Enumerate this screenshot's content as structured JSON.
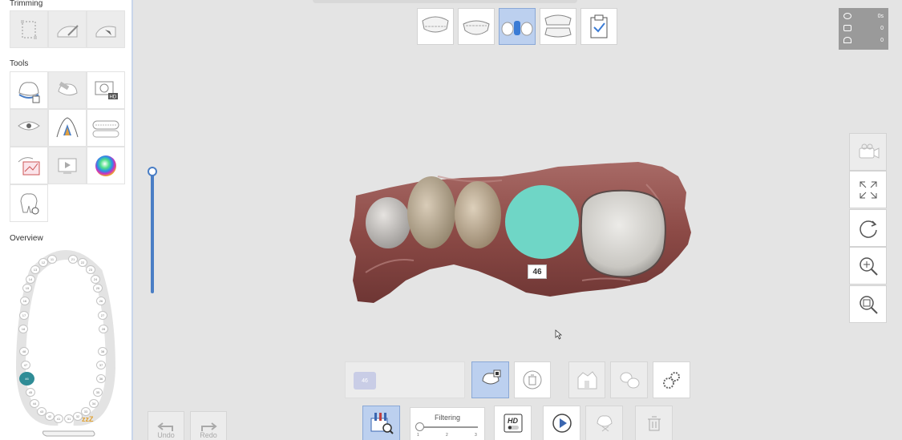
{
  "left_panel": {
    "trimming_title": "Trimming",
    "tools_title": "Tools",
    "overview_title": "Overview",
    "trimming_tools": [
      "box-select-tool",
      "brush-trim-tool",
      "lasso-trim-tool"
    ],
    "tools": [
      "margin-tool",
      "eraser-tool",
      "hd-capture-tool",
      "bite-tool",
      "palatal-tool",
      "arch-tool",
      "compare-tool",
      "video-tool",
      "color-map-tool",
      "lock-tool"
    ]
  },
  "overview": {
    "teeth": [
      {
        "n": "11"
      },
      {
        "n": "21"
      },
      {
        "n": "12"
      },
      {
        "n": "22"
      },
      {
        "n": "13"
      },
      {
        "n": "23"
      },
      {
        "n": "14"
      },
      {
        "n": "24"
      },
      {
        "n": "15"
      },
      {
        "n": "25"
      },
      {
        "n": "16"
      },
      {
        "n": "26"
      },
      {
        "n": "17"
      },
      {
        "n": "27"
      },
      {
        "n": "18"
      },
      {
        "n": "28"
      },
      {
        "n": "48"
      },
      {
        "n": "38"
      },
      {
        "n": "47"
      },
      {
        "n": "37"
      },
      {
        "n": "46",
        "selected": true
      },
      {
        "n": "36"
      },
      {
        "n": "45"
      },
      {
        "n": "35"
      },
      {
        "n": "44"
      },
      {
        "n": "34"
      },
      {
        "n": "43"
      },
      {
        "n": "33"
      },
      {
        "n": "42"
      },
      {
        "n": "32"
      },
      {
        "n": "41"
      },
      {
        "n": "31"
      }
    ],
    "sleep_label": "zzZ"
  },
  "top_toolbar": [
    "maxilla-scan",
    "mandible-scan",
    "preparation-scan",
    "occlusion-scan",
    "review-step"
  ],
  "active_step": "preparation-scan",
  "stats": {
    "time": "0s",
    "count_a": "0",
    "count_b": "0"
  },
  "side_toolbar": [
    "camera-view",
    "fit-to-screen",
    "rotate-view",
    "zoom-in",
    "zoom-window"
  ],
  "scene": {
    "tooth_label": "46",
    "highlight_color": "#6fd6c6"
  },
  "bottom": {
    "tooth_chip": "46",
    "undo_label": "Undo",
    "redo_label": "Redo",
    "filtering_label": "Filtering",
    "filter_ticks": [
      "1",
      "2",
      "3"
    ]
  },
  "colors": {
    "accent": "#4a7ec5",
    "active_bg": "#bcd0ef",
    "selected_tooth": "#2f8c96"
  }
}
